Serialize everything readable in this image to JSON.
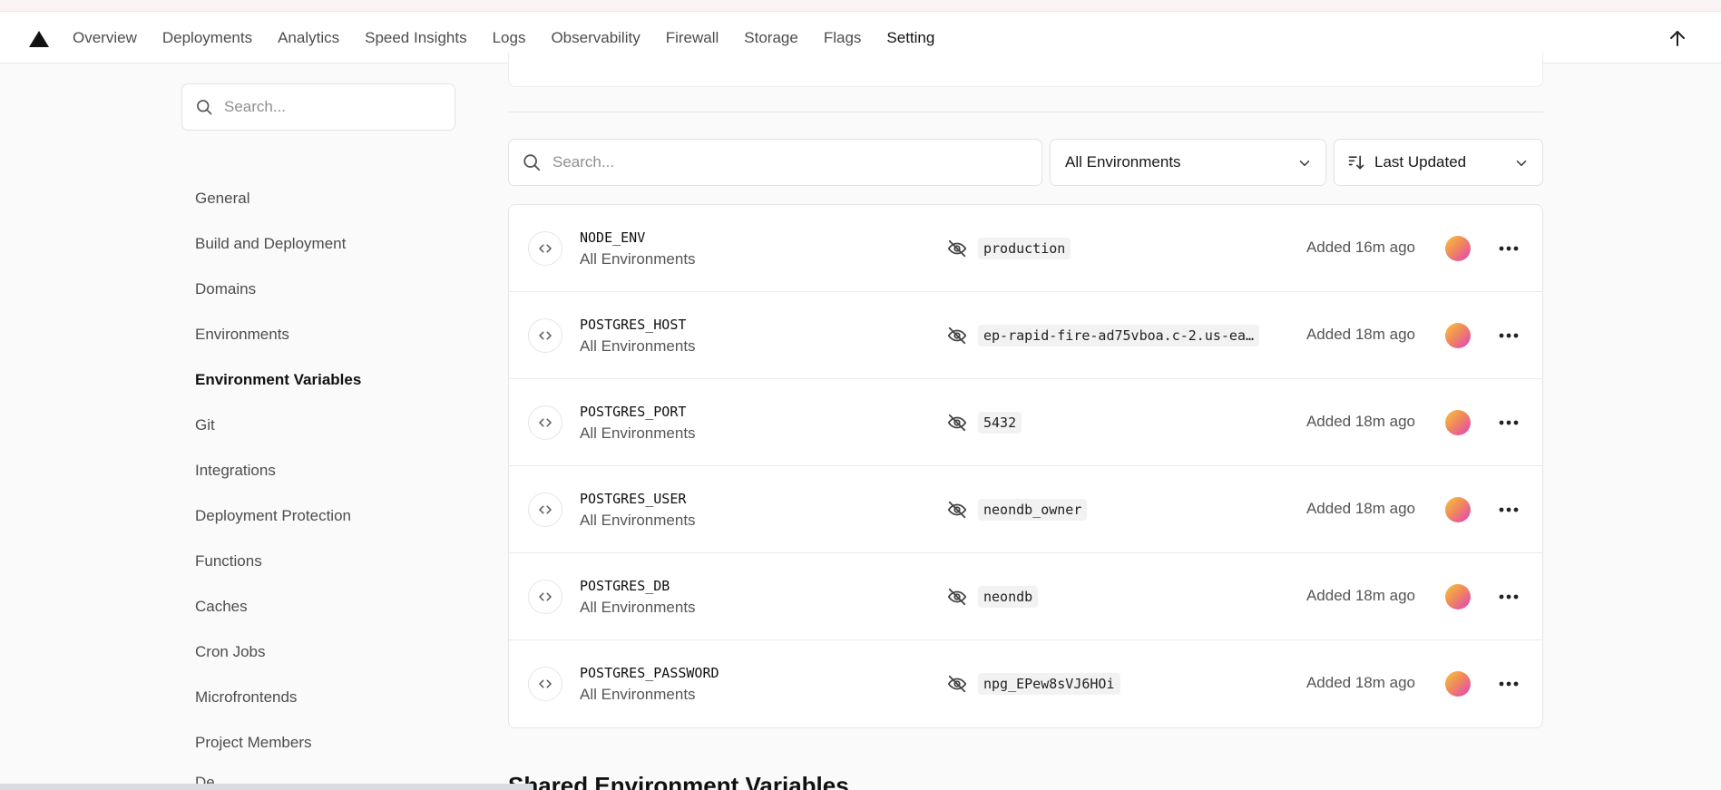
{
  "nav": {
    "tabs": [
      "Overview",
      "Deployments",
      "Analytics",
      "Speed Insights",
      "Logs",
      "Observability",
      "Firewall",
      "Storage",
      "Flags",
      "Setting"
    ],
    "active_tab": "Setting"
  },
  "sidebar": {
    "search_placeholder": "Search...",
    "items": [
      "General",
      "Build and Deployment",
      "Domains",
      "Environments",
      "Environment Variables",
      "Git",
      "Integrations",
      "Deployment Protection",
      "Functions",
      "Caches",
      "Cron Jobs",
      "Microfrontends",
      "Project Members"
    ],
    "active_item": "Environment Variables",
    "cut_off_item": "De"
  },
  "filters": {
    "search_placeholder": "Search...",
    "environment": "All Environments",
    "sort": "Last Updated"
  },
  "variables": [
    {
      "name": "NODE_ENV",
      "env": "All Environments",
      "value": "production",
      "added": "Added 16m ago"
    },
    {
      "name": "POSTGRES_HOST",
      "env": "All Environments",
      "value": "ep-rapid-fire-ad75vboa.c-2.us-ea…",
      "added": "Added 18m ago"
    },
    {
      "name": "POSTGRES_PORT",
      "env": "All Environments",
      "value": "5432",
      "added": "Added 18m ago"
    },
    {
      "name": "POSTGRES_USER",
      "env": "All Environments",
      "value": "neondb_owner",
      "added": "Added 18m ago"
    },
    {
      "name": "POSTGRES_DB",
      "env": "All Environments",
      "value": "neondb",
      "added": "Added 18m ago"
    },
    {
      "name": "POSTGRES_PASSWORD",
      "env": "All Environments",
      "value": "npg_EPew8sVJ6HOi",
      "added": "Added 18m ago"
    }
  ],
  "shared_section_title": "Shared Environment Variables",
  "icons": {
    "logo": "triangle-logo-icon",
    "scroll_top": "arrow-up-icon",
    "search": "search-icon",
    "sort": "sort-icon",
    "chevron": "chevron-down-icon",
    "code": "code-brackets-icon",
    "hidden": "eye-off-icon",
    "more": "more-horizontal-icon"
  }
}
